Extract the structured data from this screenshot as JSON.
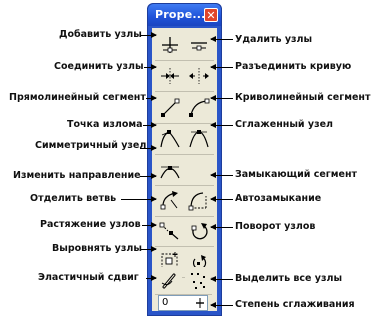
{
  "window": {
    "title": "Prope...",
    "close_symbol": "✕"
  },
  "toolbar": {
    "buttons": [
      {
        "name": "add-nodes-button",
        "icon": "add-node-icon"
      },
      {
        "name": "delete-nodes-button",
        "icon": "delete-node-icon"
      },
      {
        "name": "join-nodes-button",
        "icon": "join-nodes-icon"
      },
      {
        "name": "break-curve-button",
        "icon": "break-curve-icon"
      },
      {
        "name": "straight-segment-button",
        "icon": "straight-segment-icon"
      },
      {
        "name": "curved-segment-button",
        "icon": "curved-segment-icon"
      },
      {
        "name": "cusp-node-button",
        "icon": "cusp-node-icon"
      },
      {
        "name": "smooth-node-button",
        "icon": "smooth-node-icon"
      },
      {
        "name": "symmetric-node-button",
        "icon": "symmetric-node-icon"
      },
      {
        "name": "reverse-direction-button",
        "icon": "reverse-direction-icon"
      },
      {
        "name": "closing-segment-button",
        "icon": "closing-segment-icon"
      },
      {
        "name": "extract-subpath-button",
        "icon": "extract-subpath-icon"
      },
      {
        "name": "auto-close-button",
        "icon": "auto-close-icon"
      },
      {
        "name": "stretch-nodes-button",
        "icon": "stretch-nodes-icon"
      },
      {
        "name": "rotate-nodes-button",
        "icon": "rotate-nodes-icon"
      },
      {
        "name": "align-nodes-button",
        "icon": "align-nodes-icon"
      },
      {
        "name": "elastic-mode-button",
        "icon": "elastic-mode-icon"
      },
      {
        "name": "select-all-nodes-button",
        "icon": "select-all-nodes-icon"
      }
    ],
    "smoothness": {
      "value": "0"
    }
  },
  "labels": {
    "add_nodes": "Добавить узлы",
    "delete_nodes": "Удалить узлы",
    "join_nodes": "Соединить узлы",
    "break_curve": "Разъединить кривую",
    "straight_segment": "Прямолинейный сегмент",
    "curved_segment": "Криволинейный сегмент",
    "cusp_node": "Точка излома",
    "smooth_node": "Сглаженный узел",
    "symmetric_node": "Симметричный узел",
    "reverse_direction": "Изменить направление",
    "closing_segment": "Замыкающий сегмент",
    "extract_subpath": "Отделить ветвь",
    "auto_close": "Автозамыкание",
    "stretch_nodes": "Растяжение узлов",
    "rotate_nodes": "Поворот узлов",
    "align_nodes": "Выровнять узлы",
    "elastic_mode": "Эластичный сдвиг",
    "select_all_nodes": "Выделить все узлы",
    "smoothness": "Степень сглаживания"
  }
}
